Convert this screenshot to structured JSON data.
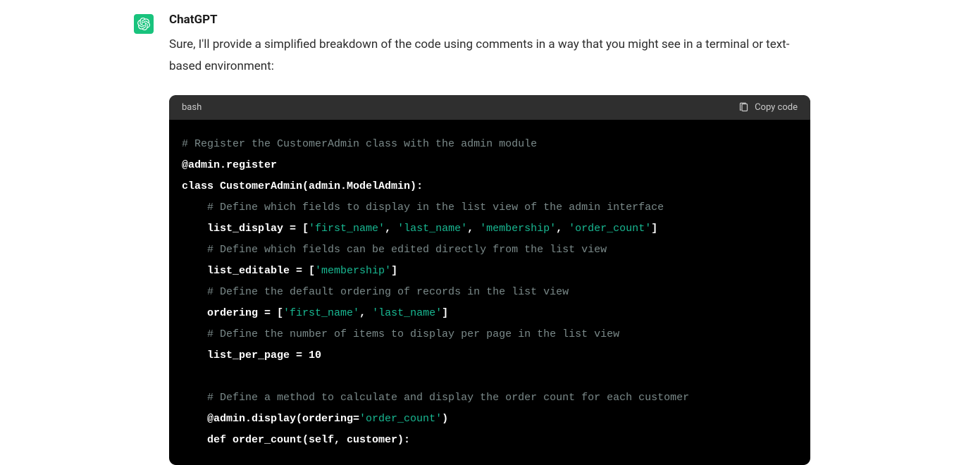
{
  "author": "ChatGPT",
  "intro": "Sure, I'll provide a simplified breakdown of the code using comments in a way that you might see in a terminal or text-based environment:",
  "code_lang": "bash",
  "copy_label": "Copy code",
  "code": {
    "l1": "# Register the CustomerAdmin class with the admin module",
    "l2": "@admin.register",
    "l3a": "class",
    "l3b": " CustomerAdmin(admin.ModelAdmin):",
    "l4": "    # Define which fields to display in the list view of the admin interface",
    "l5a": "    list_display = [",
    "l5s1": "'first_name'",
    "l5c1": ", ",
    "l5s2": "'last_name'",
    "l5c2": ", ",
    "l5s3": "'membership'",
    "l5c3": ", ",
    "l5s4": "'order_count'",
    "l5e": "]",
    "l6": "    # Define which fields can be edited directly from the list view",
    "l7a": "    list_editable = [",
    "l7s1": "'membership'",
    "l7e": "]",
    "l8": "    # Define the default ordering of records in the list view",
    "l9a": "    ordering = [",
    "l9s1": "'first_name'",
    "l9c1": ", ",
    "l9s2": "'last_name'",
    "l9e": "]",
    "l10": "    # Define the number of items to display per page in the list view",
    "l11": "    list_per_page = 10",
    "l12": "",
    "l13": "    # Define a method to calculate and display the order count for each customer",
    "l14a": "    @admin.display(ordering=",
    "l14s1": "'order_count'",
    "l14e": ")",
    "l15": "    def order_count(self, customer):"
  }
}
